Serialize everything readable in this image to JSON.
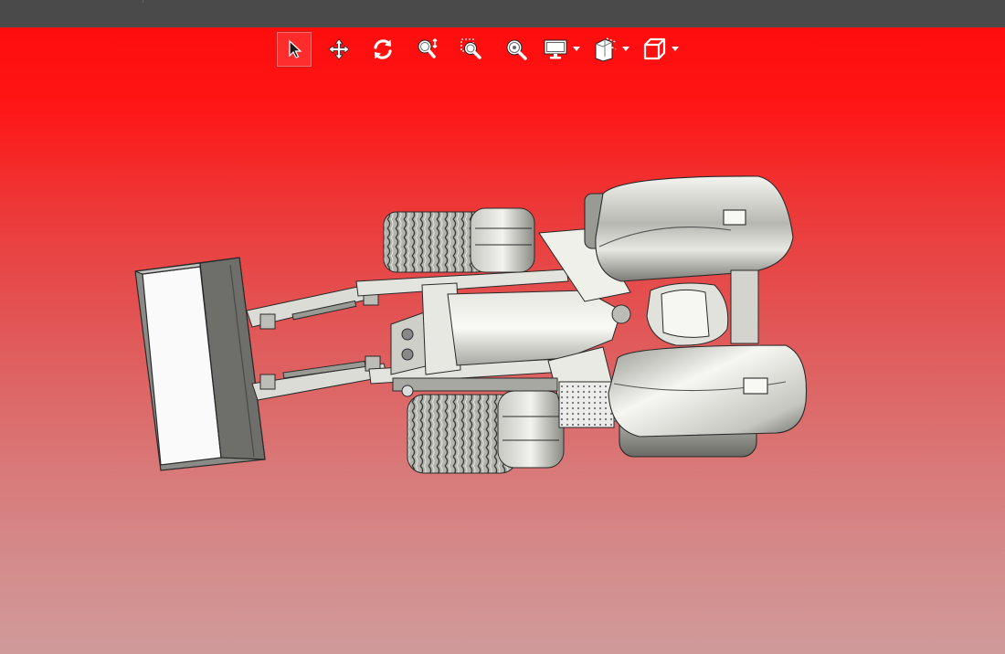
{
  "window": {
    "title": ""
  },
  "toolbar": {
    "tools": [
      {
        "name": "select",
        "icon": "select-arrow-icon",
        "active": true
      },
      {
        "name": "pan",
        "icon": "pan-move-icon",
        "active": false
      },
      {
        "name": "rotate",
        "icon": "rotate-icon",
        "active": false
      },
      {
        "name": "zoom",
        "icon": "zoom-icon",
        "active": false
      },
      {
        "name": "zoom-window",
        "icon": "zoom-window-icon",
        "active": false
      },
      {
        "name": "zoom-fit",
        "icon": "zoom-fit-icon",
        "active": false
      },
      {
        "name": "display-mode",
        "icon": "monitor-icon",
        "dropdown": true
      },
      {
        "name": "section-view",
        "icon": "section-view-icon",
        "dropdown": true
      },
      {
        "name": "standard-views",
        "icon": "cube-view-icon",
        "dropdown": true
      }
    ]
  },
  "viewport": {
    "background_top": "#ff0d0d",
    "background_bottom": "#d09a9a",
    "model": "wheel-loader-3d-model"
  },
  "colors": {
    "accent": "#ff2020",
    "titlebar": "#4a4a4a",
    "icon": "#ffffff"
  }
}
